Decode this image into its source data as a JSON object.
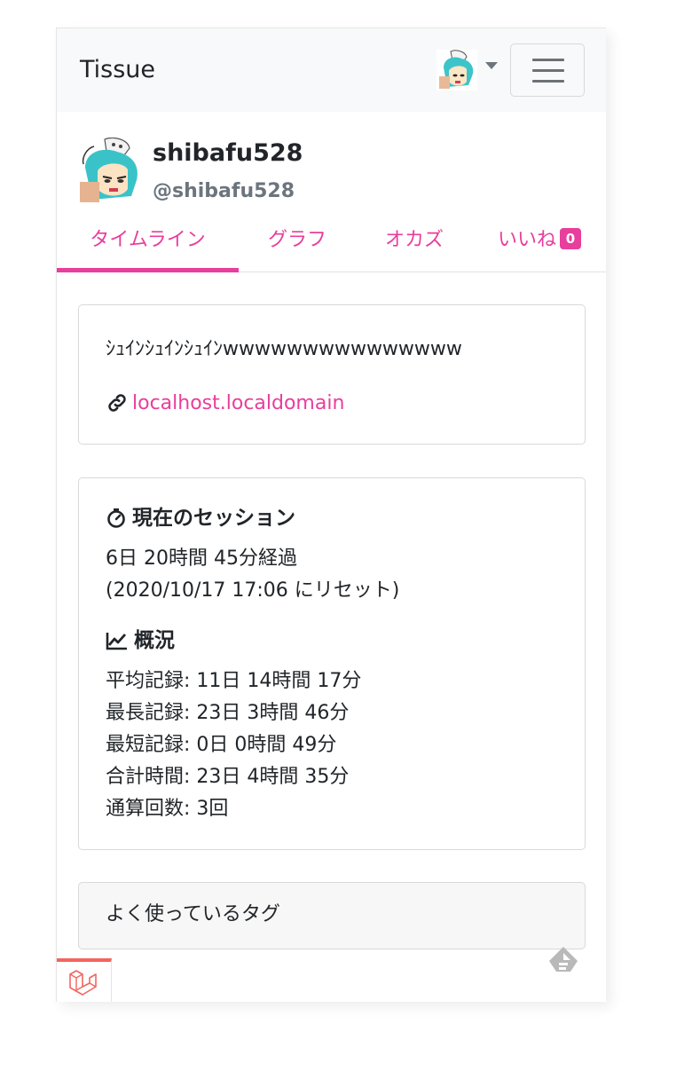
{
  "navbar": {
    "brand": "Tissue",
    "user_menu_caret_icon": "caret-down-icon",
    "toggler_icon": "hamburger-menu-icon"
  },
  "profile": {
    "display_name": "shibafu528",
    "handle": "@shibafu528"
  },
  "tabs": [
    {
      "label": "タイムライン",
      "active": true
    },
    {
      "label": "グラフ"
    },
    {
      "label": "オカズ"
    },
    {
      "label": "いいね",
      "badge": "0"
    }
  ],
  "bio": {
    "text": "ｼｭｲﾝｼｭｲﾝｼｭｲﾝwwwwwwwwwwwwwww",
    "link_icon": "link-icon",
    "link_text": "localhost.localdomain"
  },
  "current_session": {
    "title": "現在のセッション",
    "icon": "timer-icon",
    "elapsed": "6日 20時間 45分経過",
    "reset": "(2020/10/17 17:06 にリセット)"
  },
  "overview": {
    "title": "概況",
    "icon": "trend-chart-icon",
    "lines": [
      "平均記録: 11日 14時間 17分",
      "最長記録: 23日 3時間 46分",
      "最短記録: 0日 0時間 49分",
      "合計時間: 23日 4時間 35分",
      "通算回数: 3回"
    ]
  },
  "tags_card": {
    "title": "よく使っているタグ"
  },
  "debugbar": {
    "icon": "laravel-logo-icon"
  },
  "floating_icon": "feedly-icon",
  "colors": {
    "accent": "#e83e9c",
    "navbar_bg": "#f8f9fa",
    "muted": "#6c757d",
    "debugbar_accent": "#f4645f"
  }
}
